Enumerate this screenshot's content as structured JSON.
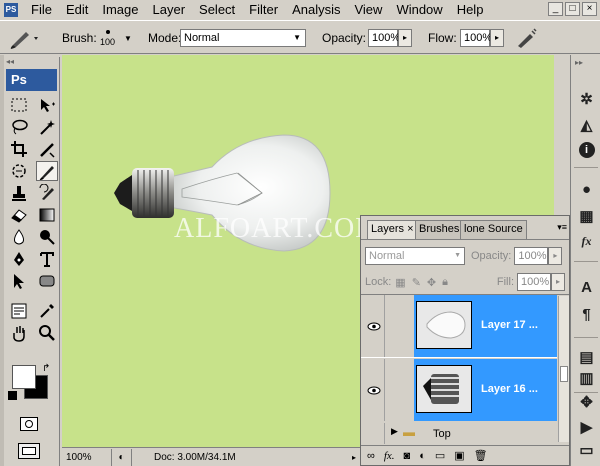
{
  "menu": {
    "app_icon": "PS",
    "items": [
      "File",
      "Edit",
      "Image",
      "Layer",
      "Select",
      "Filter",
      "Analysis",
      "View",
      "Window",
      "Help"
    ],
    "window_controls": [
      "_",
      "□",
      "×"
    ]
  },
  "options": {
    "brush_label": "Brush:",
    "brush_size": "100",
    "mode_label": "Mode:",
    "mode_value": "Normal",
    "opacity_label": "Opacity:",
    "opacity_value": "100%",
    "flow_label": "Flow:",
    "flow_value": "100%"
  },
  "toolbox": {
    "logo": "Ps",
    "grip": "◂◂"
  },
  "canvas": {
    "background": "#c7e28a",
    "watermark": "ALFOART.COM"
  },
  "status": {
    "zoom": "100%",
    "doc_info": "Doc: 3.00M/34.1M"
  },
  "layers_panel": {
    "tabs": [
      "Layers ×",
      "Brushes",
      "lone Source"
    ],
    "blend_mode": "Normal",
    "opacity_label": "Opacity:",
    "opacity_value": "100%",
    "lock_label": "Lock:",
    "fill_label": "Fill:",
    "fill_value": "100%",
    "layers": [
      {
        "name": "Layer 17 ...",
        "visible": true,
        "selected": true
      },
      {
        "name": "Layer 16 ...",
        "visible": true,
        "selected": true
      },
      {
        "name": "Top",
        "type": "group",
        "visible": false
      }
    ],
    "accent": "#3399ff"
  },
  "dock": {
    "type_char": "A",
    "para_char": "¶",
    "fx_char": "fx"
  }
}
